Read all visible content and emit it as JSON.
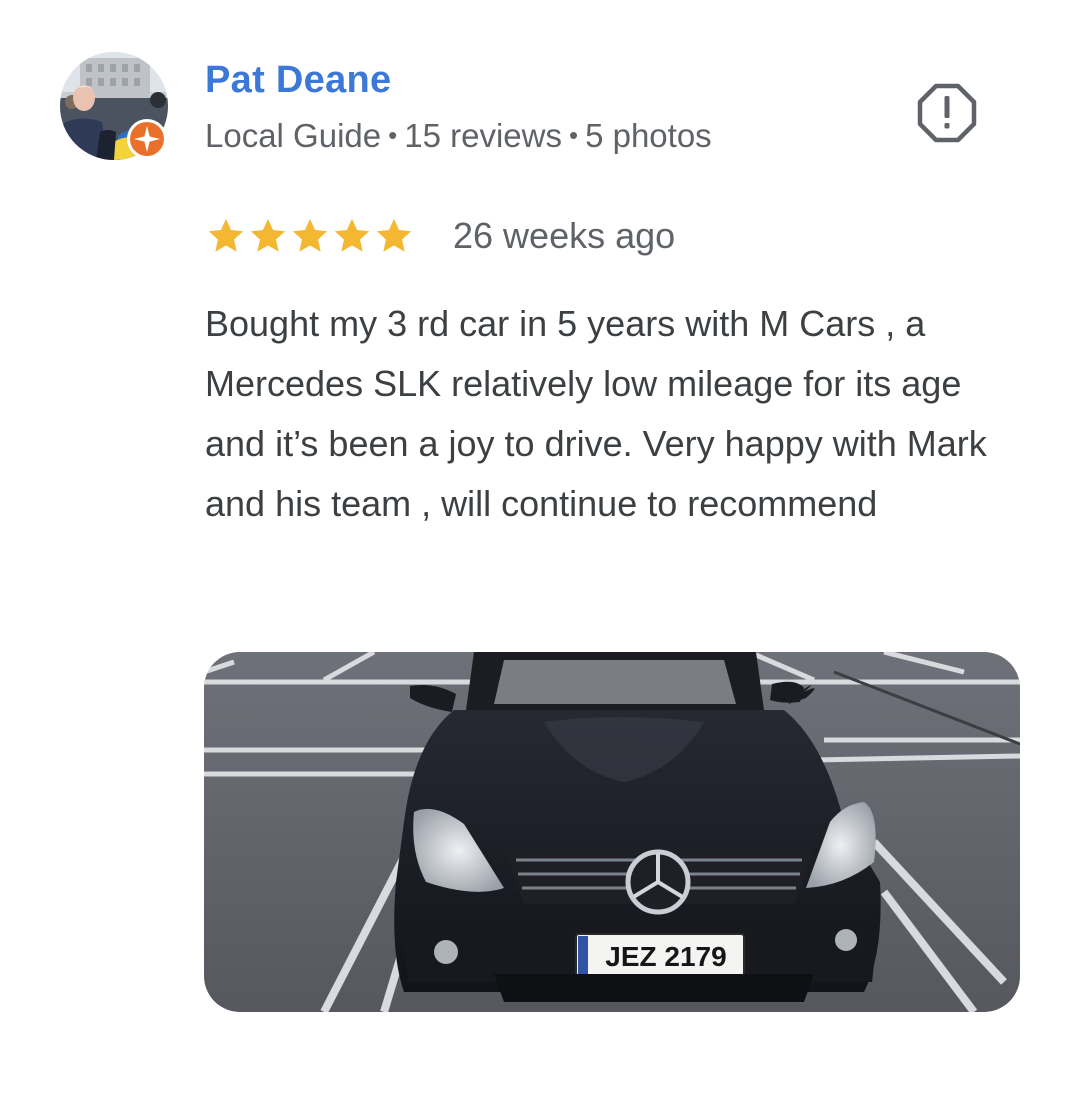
{
  "reviewer": {
    "name": "Pat Deane",
    "badge": "Local Guide",
    "reviews": "15 reviews",
    "photos": "5 photos",
    "separator": "•"
  },
  "review": {
    "rating": 5,
    "max_rating": 5,
    "date": "26 weeks ago",
    "text": "Bought my 3 rd car in 5 years with M Cars , a Mercedes SLK relatively low mileage for its age and it’s been a joy to drive. Very happy with Mark and his team , will continue to recommend"
  },
  "photo": {
    "plate": "JEZ 2179"
  },
  "icons": {
    "badge": "local-guide-star-icon",
    "report": "report-flag-icon",
    "star": "star-icon"
  },
  "colors": {
    "name_link": "#3b78d8",
    "star": "#f4b731",
    "badge": "#e8702a",
    "secondary_text": "#5f6368",
    "body_text": "#3c4043"
  }
}
